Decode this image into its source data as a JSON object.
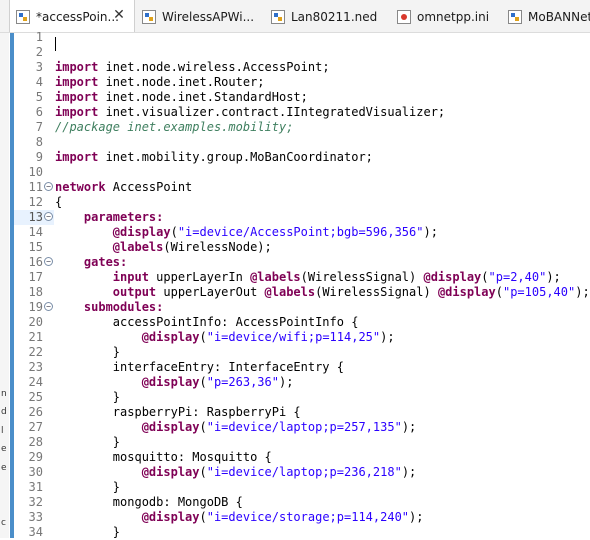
{
  "tabs": [
    {
      "label": "*accessPoin...",
      "icon": "ned-file-icon",
      "active": true
    },
    {
      "label": "WirelessAPWi...",
      "icon": "ned-file-icon",
      "active": false
    },
    {
      "label": "Lan80211.ned",
      "icon": "ned-file-icon",
      "active": false
    },
    {
      "label": "omnetpp.ini",
      "icon": "ini-file-icon",
      "active": false
    },
    {
      "label": "MoBANNetw",
      "icon": "ned-file-icon",
      "active": false
    }
  ],
  "close_glyph": "✕",
  "left_strip_chars": [
    "n",
    "d",
    "l",
    "e",
    "e",
    "c"
  ],
  "current_line": 13,
  "lines": [
    {
      "n": 1,
      "tokens": []
    },
    {
      "n": 2,
      "tokens": []
    },
    {
      "n": 3,
      "tokens": [
        {
          "t": "import",
          "c": "kw"
        },
        {
          "t": " inet.node.wireless.AccessPoint;",
          "c": ""
        }
      ]
    },
    {
      "n": 4,
      "tokens": [
        {
          "t": "import",
          "c": "kw"
        },
        {
          "t": " inet.node.inet.Router;",
          "c": ""
        }
      ]
    },
    {
      "n": 5,
      "tokens": [
        {
          "t": "import",
          "c": "kw"
        },
        {
          "t": " inet.node.inet.StandardHost;",
          "c": ""
        }
      ]
    },
    {
      "n": 6,
      "tokens": [
        {
          "t": "import",
          "c": "kw"
        },
        {
          "t": " inet.visualizer.contract.IIntegratedVisualizer;",
          "c": ""
        }
      ]
    },
    {
      "n": 7,
      "tokens": [
        {
          "t": "//package inet.examples.mobility;",
          "c": "com"
        }
      ]
    },
    {
      "n": 8,
      "tokens": []
    },
    {
      "n": 9,
      "tokens": [
        {
          "t": "import",
          "c": "kw"
        },
        {
          "t": " inet.mobility.group.MoBanCoordinator;",
          "c": ""
        }
      ]
    },
    {
      "n": 10,
      "tokens": []
    },
    {
      "n": 11,
      "fold": "−",
      "tokens": [
        {
          "t": "network",
          "c": "kw"
        },
        {
          "t": " AccessPoint",
          "c": ""
        }
      ]
    },
    {
      "n": 12,
      "tokens": [
        {
          "t": "{",
          "c": ""
        }
      ]
    },
    {
      "n": 13,
      "fold": "−",
      "tokens": [
        {
          "t": "    ",
          "c": ""
        },
        {
          "t": "parameters:",
          "c": "kw"
        }
      ]
    },
    {
      "n": 14,
      "tokens": [
        {
          "t": "        ",
          "c": ""
        },
        {
          "t": "@display",
          "c": "kw"
        },
        {
          "t": "(",
          "c": ""
        },
        {
          "t": "\"i=device/AccessPoint;bgb=596,356\"",
          "c": "str"
        },
        {
          "t": ");",
          "c": ""
        }
      ]
    },
    {
      "n": 15,
      "tokens": [
        {
          "t": "        ",
          "c": ""
        },
        {
          "t": "@labels",
          "c": "kw"
        },
        {
          "t": "(WirelessNode);",
          "c": ""
        }
      ]
    },
    {
      "n": 16,
      "fold": "−",
      "tokens": [
        {
          "t": "    ",
          "c": ""
        },
        {
          "t": "gates:",
          "c": "kw"
        }
      ]
    },
    {
      "n": 17,
      "tokens": [
        {
          "t": "        ",
          "c": ""
        },
        {
          "t": "input",
          "c": "kw"
        },
        {
          "t": " upperLayerIn ",
          "c": ""
        },
        {
          "t": "@labels",
          "c": "kw"
        },
        {
          "t": "(WirelessSignal) ",
          "c": ""
        },
        {
          "t": "@display",
          "c": "kw"
        },
        {
          "t": "(",
          "c": ""
        },
        {
          "t": "\"p=2,40\"",
          "c": "str"
        },
        {
          "t": ");",
          "c": ""
        }
      ]
    },
    {
      "n": 18,
      "tokens": [
        {
          "t": "        ",
          "c": ""
        },
        {
          "t": "output",
          "c": "kw"
        },
        {
          "t": " upperLayerOut ",
          "c": ""
        },
        {
          "t": "@labels",
          "c": "kw"
        },
        {
          "t": "(WirelessSignal) ",
          "c": ""
        },
        {
          "t": "@display",
          "c": "kw"
        },
        {
          "t": "(",
          "c": ""
        },
        {
          "t": "\"p=105,40\"",
          "c": "str"
        },
        {
          "t": ");",
          "c": ""
        }
      ]
    },
    {
      "n": 19,
      "fold": "−",
      "tokens": [
        {
          "t": "    ",
          "c": ""
        },
        {
          "t": "submodules:",
          "c": "kw"
        }
      ]
    },
    {
      "n": 20,
      "tokens": [
        {
          "t": "        accessPointInfo: AccessPointInfo {",
          "c": ""
        }
      ]
    },
    {
      "n": 21,
      "tokens": [
        {
          "t": "            ",
          "c": ""
        },
        {
          "t": "@display",
          "c": "kw"
        },
        {
          "t": "(",
          "c": ""
        },
        {
          "t": "\"i=device/wifi;p=114,25\"",
          "c": "str"
        },
        {
          "t": ");",
          "c": ""
        }
      ]
    },
    {
      "n": 22,
      "tokens": [
        {
          "t": "        }",
          "c": ""
        }
      ]
    },
    {
      "n": 23,
      "tokens": [
        {
          "t": "        interfaceEntry: InterfaceEntry {",
          "c": ""
        }
      ]
    },
    {
      "n": 24,
      "tokens": [
        {
          "t": "            ",
          "c": ""
        },
        {
          "t": "@display",
          "c": "kw"
        },
        {
          "t": "(",
          "c": ""
        },
        {
          "t": "\"p=263,36\"",
          "c": "str"
        },
        {
          "t": ");",
          "c": ""
        }
      ]
    },
    {
      "n": 25,
      "tokens": [
        {
          "t": "        }",
          "c": ""
        }
      ]
    },
    {
      "n": 26,
      "tokens": [
        {
          "t": "        raspberryPi: RaspberryPi {",
          "c": ""
        }
      ]
    },
    {
      "n": 27,
      "tokens": [
        {
          "t": "            ",
          "c": ""
        },
        {
          "t": "@display",
          "c": "kw"
        },
        {
          "t": "(",
          "c": ""
        },
        {
          "t": "\"i=device/laptop;p=257,135\"",
          "c": "str"
        },
        {
          "t": ");",
          "c": ""
        }
      ]
    },
    {
      "n": 28,
      "tokens": [
        {
          "t": "        }",
          "c": ""
        }
      ]
    },
    {
      "n": 29,
      "tokens": [
        {
          "t": "        mosquitto: Mosquitto {",
          "c": ""
        }
      ]
    },
    {
      "n": 30,
      "tokens": [
        {
          "t": "            ",
          "c": ""
        },
        {
          "t": "@display",
          "c": "kw"
        },
        {
          "t": "(",
          "c": ""
        },
        {
          "t": "\"i=device/laptop;p=236,218\"",
          "c": "str"
        },
        {
          "t": ");",
          "c": ""
        }
      ]
    },
    {
      "n": 31,
      "tokens": [
        {
          "t": "        }",
          "c": ""
        }
      ]
    },
    {
      "n": 32,
      "tokens": [
        {
          "t": "        mongodb: MongoDB {",
          "c": ""
        }
      ]
    },
    {
      "n": 33,
      "tokens": [
        {
          "t": "            ",
          "c": ""
        },
        {
          "t": "@display",
          "c": "kw"
        },
        {
          "t": "(",
          "c": ""
        },
        {
          "t": "\"i=device/storage;p=114,240\"",
          "c": "str"
        },
        {
          "t": ");",
          "c": ""
        }
      ]
    },
    {
      "n": 34,
      "tokens": [
        {
          "t": "        }",
          "c": ""
        }
      ]
    }
  ]
}
